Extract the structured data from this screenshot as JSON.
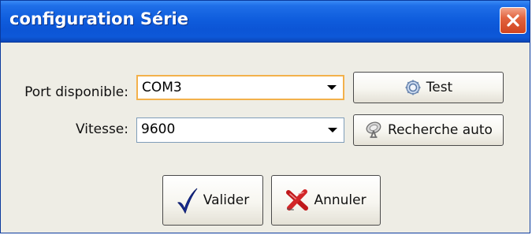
{
  "window": {
    "title": "configuration Série",
    "close_icon": "close-x-icon"
  },
  "form": {
    "port_label": "Port disponible:",
    "port_value": "COM3",
    "speed_label": "Vitesse:",
    "speed_value": "9600"
  },
  "buttons": {
    "test_label": "Test",
    "test_icon": "magnifier-gear-icon",
    "search_label": "Recherche auto",
    "search_icon": "satellite-dish-icon",
    "validate_label": "Valider",
    "validate_icon": "checkmark-icon",
    "cancel_label": "Annuler",
    "cancel_icon": "red-x-icon"
  },
  "colors": {
    "titlebar": "#0c55d6",
    "close_button": "#e2643f",
    "focus_border": "#f3b14b",
    "dialog_background": "#eeede5"
  }
}
